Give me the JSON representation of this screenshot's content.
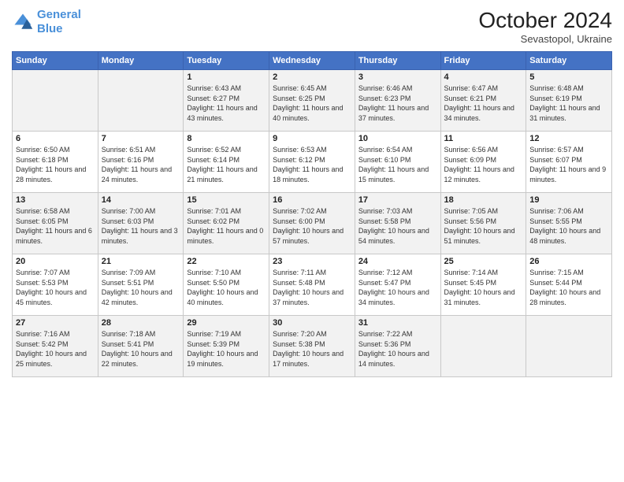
{
  "logo": {
    "line1": "General",
    "line2": "Blue"
  },
  "title": "October 2024",
  "location": "Sevastopol, Ukraine",
  "days_header": [
    "Sunday",
    "Monday",
    "Tuesday",
    "Wednesday",
    "Thursday",
    "Friday",
    "Saturday"
  ],
  "weeks": [
    [
      {
        "day": "",
        "content": ""
      },
      {
        "day": "",
        "content": ""
      },
      {
        "day": "1",
        "content": "Sunrise: 6:43 AM\nSunset: 6:27 PM\nDaylight: 11 hours and 43 minutes."
      },
      {
        "day": "2",
        "content": "Sunrise: 6:45 AM\nSunset: 6:25 PM\nDaylight: 11 hours and 40 minutes."
      },
      {
        "day": "3",
        "content": "Sunrise: 6:46 AM\nSunset: 6:23 PM\nDaylight: 11 hours and 37 minutes."
      },
      {
        "day": "4",
        "content": "Sunrise: 6:47 AM\nSunset: 6:21 PM\nDaylight: 11 hours and 34 minutes."
      },
      {
        "day": "5",
        "content": "Sunrise: 6:48 AM\nSunset: 6:19 PM\nDaylight: 11 hours and 31 minutes."
      }
    ],
    [
      {
        "day": "6",
        "content": "Sunrise: 6:50 AM\nSunset: 6:18 PM\nDaylight: 11 hours and 28 minutes."
      },
      {
        "day": "7",
        "content": "Sunrise: 6:51 AM\nSunset: 6:16 PM\nDaylight: 11 hours and 24 minutes."
      },
      {
        "day": "8",
        "content": "Sunrise: 6:52 AM\nSunset: 6:14 PM\nDaylight: 11 hours and 21 minutes."
      },
      {
        "day": "9",
        "content": "Sunrise: 6:53 AM\nSunset: 6:12 PM\nDaylight: 11 hours and 18 minutes."
      },
      {
        "day": "10",
        "content": "Sunrise: 6:54 AM\nSunset: 6:10 PM\nDaylight: 11 hours and 15 minutes."
      },
      {
        "day": "11",
        "content": "Sunrise: 6:56 AM\nSunset: 6:09 PM\nDaylight: 11 hours and 12 minutes."
      },
      {
        "day": "12",
        "content": "Sunrise: 6:57 AM\nSunset: 6:07 PM\nDaylight: 11 hours and 9 minutes."
      }
    ],
    [
      {
        "day": "13",
        "content": "Sunrise: 6:58 AM\nSunset: 6:05 PM\nDaylight: 11 hours and 6 minutes."
      },
      {
        "day": "14",
        "content": "Sunrise: 7:00 AM\nSunset: 6:03 PM\nDaylight: 11 hours and 3 minutes."
      },
      {
        "day": "15",
        "content": "Sunrise: 7:01 AM\nSunset: 6:02 PM\nDaylight: 11 hours and 0 minutes."
      },
      {
        "day": "16",
        "content": "Sunrise: 7:02 AM\nSunset: 6:00 PM\nDaylight: 10 hours and 57 minutes."
      },
      {
        "day": "17",
        "content": "Sunrise: 7:03 AM\nSunset: 5:58 PM\nDaylight: 10 hours and 54 minutes."
      },
      {
        "day": "18",
        "content": "Sunrise: 7:05 AM\nSunset: 5:56 PM\nDaylight: 10 hours and 51 minutes."
      },
      {
        "day": "19",
        "content": "Sunrise: 7:06 AM\nSunset: 5:55 PM\nDaylight: 10 hours and 48 minutes."
      }
    ],
    [
      {
        "day": "20",
        "content": "Sunrise: 7:07 AM\nSunset: 5:53 PM\nDaylight: 10 hours and 45 minutes."
      },
      {
        "day": "21",
        "content": "Sunrise: 7:09 AM\nSunset: 5:51 PM\nDaylight: 10 hours and 42 minutes."
      },
      {
        "day": "22",
        "content": "Sunrise: 7:10 AM\nSunset: 5:50 PM\nDaylight: 10 hours and 40 minutes."
      },
      {
        "day": "23",
        "content": "Sunrise: 7:11 AM\nSunset: 5:48 PM\nDaylight: 10 hours and 37 minutes."
      },
      {
        "day": "24",
        "content": "Sunrise: 7:12 AM\nSunset: 5:47 PM\nDaylight: 10 hours and 34 minutes."
      },
      {
        "day": "25",
        "content": "Sunrise: 7:14 AM\nSunset: 5:45 PM\nDaylight: 10 hours and 31 minutes."
      },
      {
        "day": "26",
        "content": "Sunrise: 7:15 AM\nSunset: 5:44 PM\nDaylight: 10 hours and 28 minutes."
      }
    ],
    [
      {
        "day": "27",
        "content": "Sunrise: 7:16 AM\nSunset: 5:42 PM\nDaylight: 10 hours and 25 minutes."
      },
      {
        "day": "28",
        "content": "Sunrise: 7:18 AM\nSunset: 5:41 PM\nDaylight: 10 hours and 22 minutes."
      },
      {
        "day": "29",
        "content": "Sunrise: 7:19 AM\nSunset: 5:39 PM\nDaylight: 10 hours and 19 minutes."
      },
      {
        "day": "30",
        "content": "Sunrise: 7:20 AM\nSunset: 5:38 PM\nDaylight: 10 hours and 17 minutes."
      },
      {
        "day": "31",
        "content": "Sunrise: 7:22 AM\nSunset: 5:36 PM\nDaylight: 10 hours and 14 minutes."
      },
      {
        "day": "",
        "content": ""
      },
      {
        "day": "",
        "content": ""
      }
    ]
  ]
}
